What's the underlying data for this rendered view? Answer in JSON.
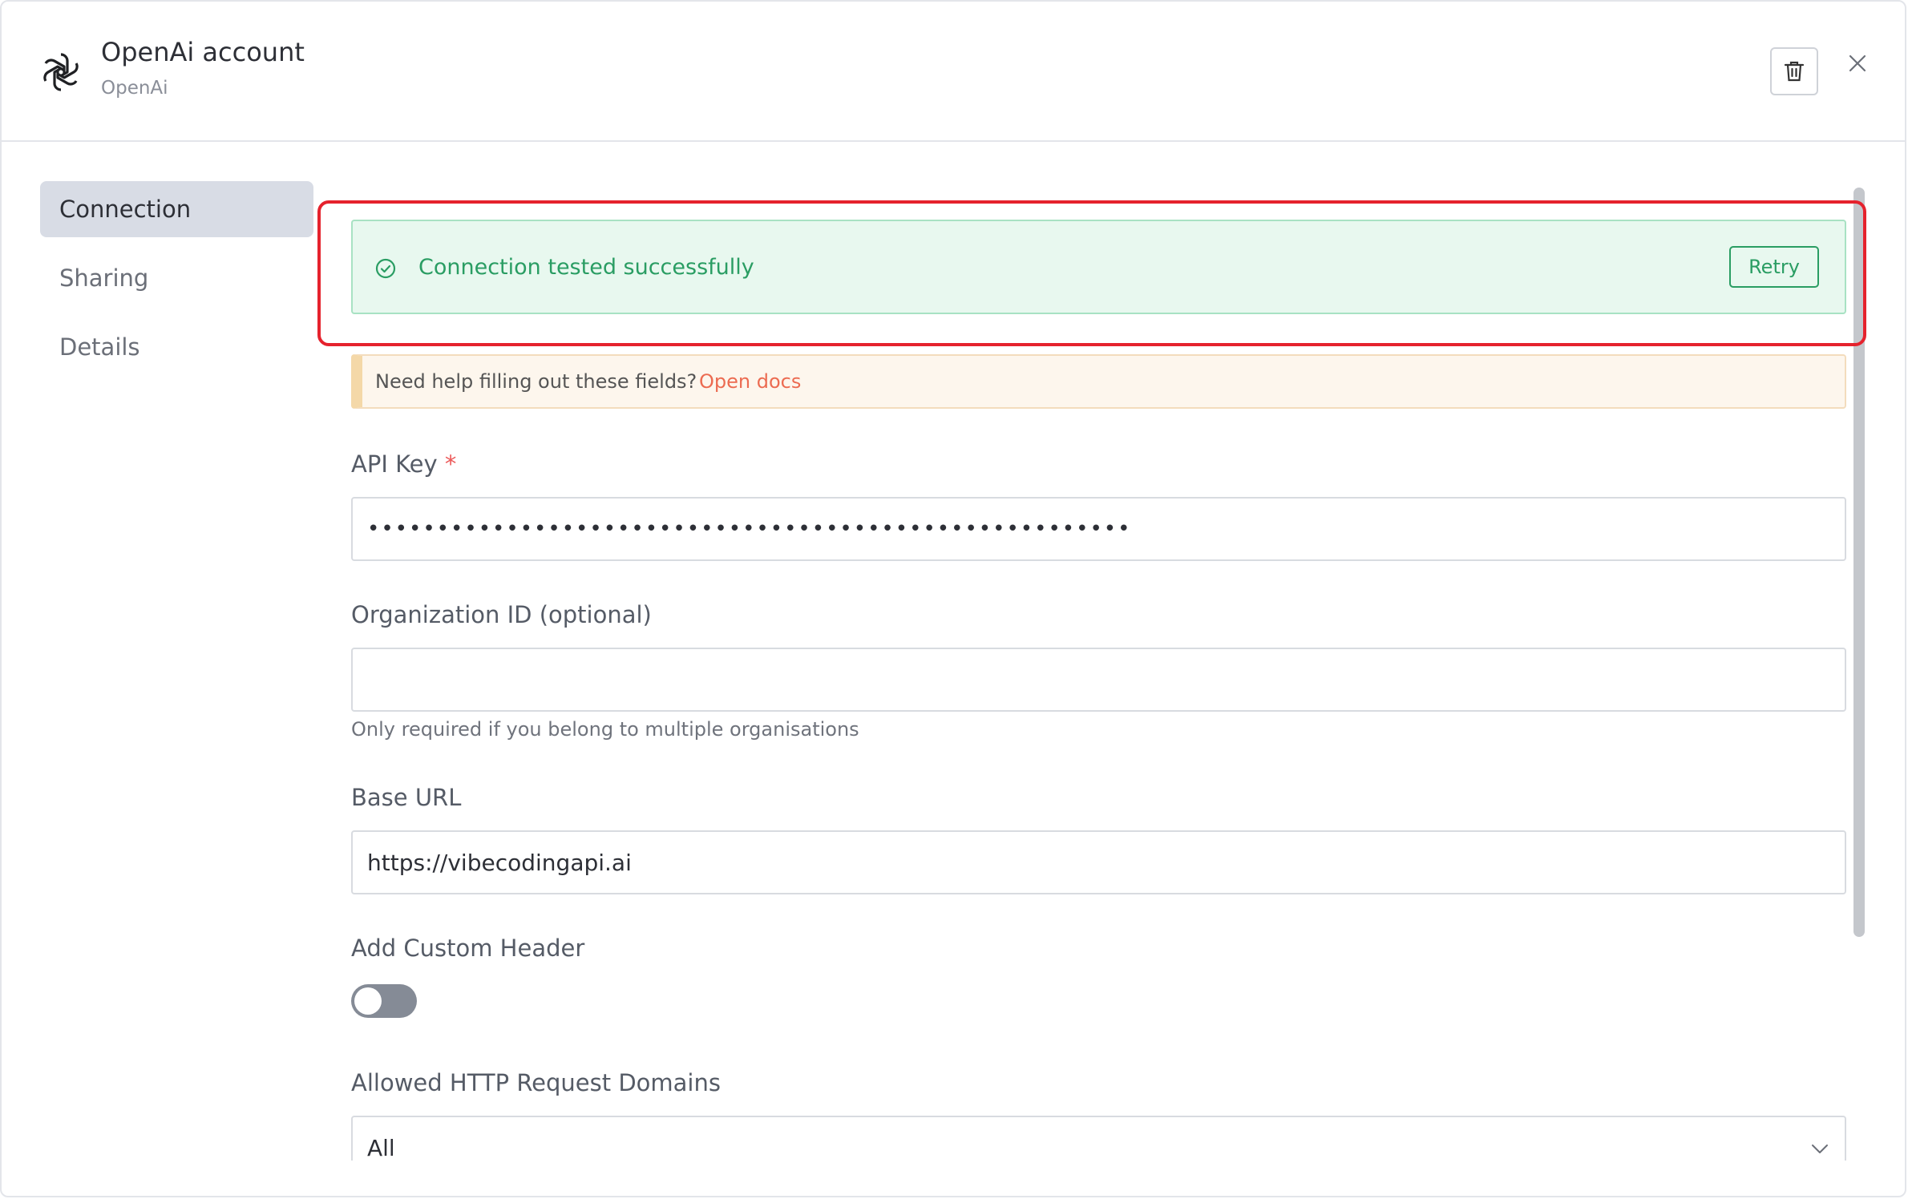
{
  "header": {
    "title": "OpenAi account",
    "subtitle": "OpenAi"
  },
  "sidebar": {
    "items": [
      {
        "label": "Connection",
        "active": true
      },
      {
        "label": "Sharing",
        "active": false
      },
      {
        "label": "Details",
        "active": false
      }
    ]
  },
  "banner": {
    "success_text": "Connection tested successfully",
    "retry_label": "Retry"
  },
  "help": {
    "text": "Need help filling out these fields?",
    "link": "Open docs"
  },
  "form": {
    "api_key_label": "API Key",
    "required_mark": "*",
    "api_key_value": "•••••••••••••••••••••••••••••••••••••••••••••••••••••••",
    "org_label": "Organization ID (optional)",
    "org_value": "",
    "org_hint": "Only required if you belong to multiple organisations",
    "base_url_label": "Base URL",
    "base_url_value": "https://vibecodingapi.ai",
    "custom_header_label": "Add Custom Header",
    "custom_header_enabled": false,
    "domains_label": "Allowed HTTP Request Domains",
    "domains_value": "All"
  },
  "colors": {
    "success": "#2a9d63",
    "highlight": "#e5222d",
    "link": "#ec6b51"
  }
}
